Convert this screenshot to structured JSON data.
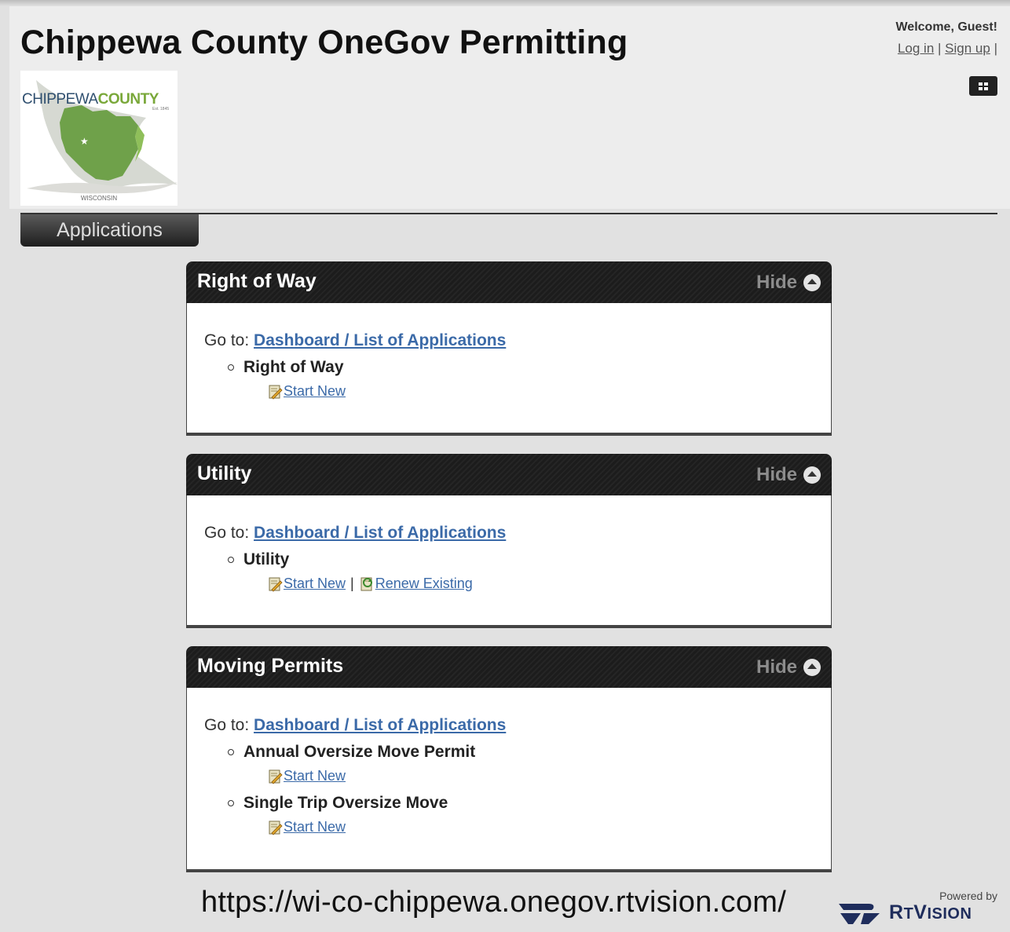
{
  "header": {
    "title": "Chippewa County OneGov Permitting",
    "welcome": "Welcome, Guest!",
    "login_label": "Log in",
    "separator": "|",
    "signup_label": "Sign up",
    "trailing_separator": "|"
  },
  "logo": {
    "text_part1": "CHIPPEWA",
    "text_part2": "COUNTY",
    "est": "Est. 1845",
    "state": "WISCONSIN",
    "colors": {
      "green": "#7aa83a",
      "navy": "#2f4f6f"
    }
  },
  "nav": {
    "tab_label": "Applications"
  },
  "panels": [
    {
      "title": "Right of Way",
      "hide_label": "Hide",
      "goto_label": "Go to:",
      "goto_link": "Dashboard / List of Applications",
      "items": [
        {
          "name": "Right of Way",
          "start_label": "Start New"
        }
      ]
    },
    {
      "title": "Utility",
      "hide_label": "Hide",
      "goto_label": "Go to:",
      "goto_link": "Dashboard / List of Applications",
      "items": [
        {
          "name": "Utility",
          "start_label": "Start New",
          "separator": "|",
          "renew_label": "Renew Existing"
        }
      ]
    },
    {
      "title": "Moving Permits",
      "hide_label": "Hide",
      "goto_label": "Go to:",
      "goto_link": "Dashboard / List of Applications",
      "items": [
        {
          "name": "Annual Oversize Move Permit",
          "start_label": "Start New"
        },
        {
          "name": "Single Trip Oversize Move",
          "start_label": "Start New"
        }
      ]
    }
  ],
  "footer": {
    "url": "https://wi-co-chippewa.onegov.rtvision.com/",
    "powered_by": "Powered by",
    "brand_r": "R",
    "brand_t": "T",
    "brand_v": "V",
    "brand_ision": "ISION"
  },
  "icons": {
    "apps_menu": "grid-icon",
    "hide": "collapse-up-icon",
    "start_new": "new-document-icon",
    "renew": "renew-document-icon"
  }
}
